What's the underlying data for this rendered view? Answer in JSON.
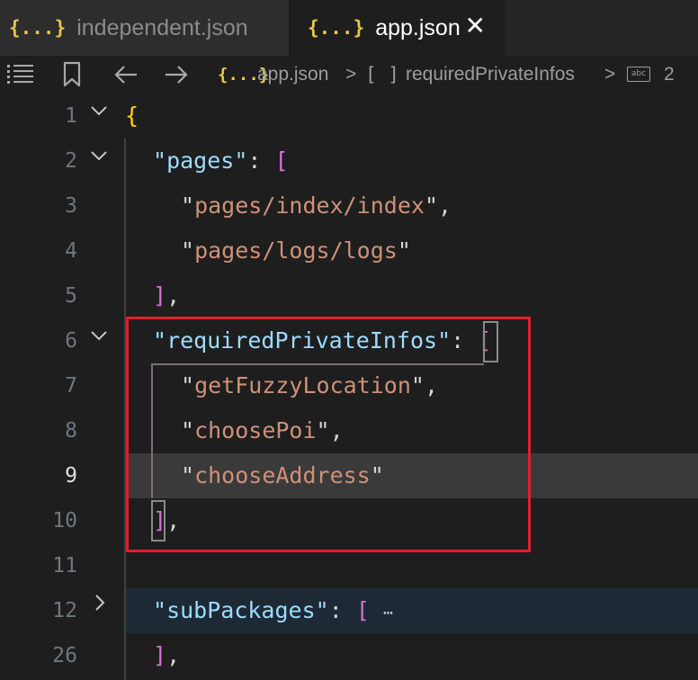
{
  "tabs": [
    {
      "icon": "{...}",
      "label": "independent.json",
      "active": false
    },
    {
      "icon": "{...}",
      "label": "app.json",
      "active": true,
      "close": "✕"
    }
  ],
  "breadcrumb": {
    "file_icon": "{...}",
    "file": "app.json",
    "sep1": ">",
    "array_icon": "[ ]",
    "segment": "requiredPrivateInfos",
    "sep2": ">",
    "string_icon": "abc",
    "index": "2"
  },
  "editor": {
    "active_line": "9",
    "lines": [
      {
        "num": "1",
        "fold": "expanded"
      },
      {
        "num": "2",
        "fold": "expanded",
        "key": "pages"
      },
      {
        "num": "3",
        "value": "pages/index/index"
      },
      {
        "num": "4",
        "value": "pages/logs/logs"
      },
      {
        "num": "5"
      },
      {
        "num": "6",
        "fold": "expanded",
        "key": "requiredPrivateInfos"
      },
      {
        "num": "7",
        "value": "getFuzzyLocation"
      },
      {
        "num": "8",
        "value": "choosePoi"
      },
      {
        "num": "9",
        "value": "chooseAddress"
      },
      {
        "num": "10"
      },
      {
        "num": "11"
      },
      {
        "num": "12",
        "fold": "collapsed",
        "key": "subPackages"
      },
      {
        "num": "26"
      }
    ]
  },
  "highlight_color": "#e0202a"
}
